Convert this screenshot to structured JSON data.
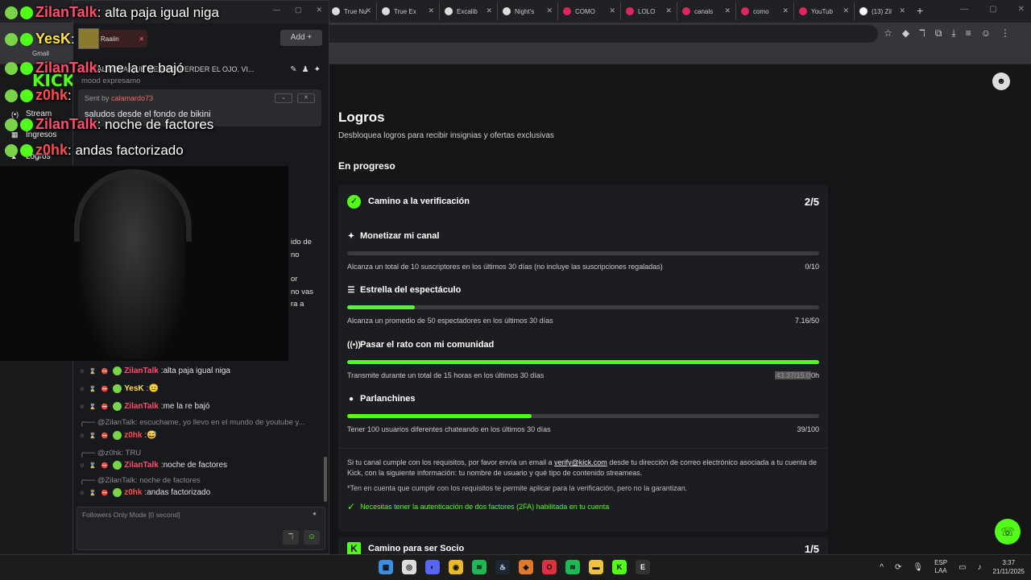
{
  "browser": {
    "tabs": [
      {
        "label": "True Nu",
        "color": "#dddddd"
      },
      {
        "label": "True Ex",
        "color": "#dddddd"
      },
      {
        "label": "Excalib",
        "color": "#dddddd"
      },
      {
        "label": "Night's",
        "color": "#dddddd"
      },
      {
        "label": "COMO",
        "color": "#e0245e"
      },
      {
        "label": "LOLO",
        "color": "#e0245e"
      },
      {
        "label": "canals",
        "color": "#e0245e"
      },
      {
        "label": "como",
        "color": "#e0245e"
      },
      {
        "label": "YouTub",
        "color": "#e0245e"
      },
      {
        "label": "(13) Zil",
        "color": "#ffffff"
      }
    ],
    "new_tab": "+",
    "bookmark": "Gmail"
  },
  "sidebar": {
    "logo": "KICK",
    "items": [
      {
        "label": "Stream",
        "icon": "(•)"
      },
      {
        "label": "Ingresos",
        "icon": "▦"
      },
      {
        "label": "Logros",
        "icon": "⧗"
      }
    ]
  },
  "chat_window": {
    "user_chip": "Raaiin",
    "add_label": "Add",
    "title": "EN TAL NENA QUE ME HIZO PERDER EL OJO. VI...",
    "subtitle": "mood expresamo",
    "pinned": {
      "sent_by_label": "Sent by",
      "sender": "calamardo73",
      "message": "saludos desde el fondo de bikini"
    },
    "partial_lines": [
      "ido de",
      "no",
      "or",
      "no vas",
      "ra a"
    ],
    "messages": [
      {
        "type": "msg",
        "user": "ZilanTalk",
        "color": "#ff4d6d",
        "text": "alta paja igual niga"
      },
      {
        "type": "msg",
        "user": "YesK",
        "color": "#ffe14d",
        "text": "😐"
      },
      {
        "type": "msg",
        "user": "ZilanTalk",
        "color": "#ff4d6d",
        "text": "me la re bajó"
      },
      {
        "type": "reply",
        "text": "@ZilanTalk: escuchame, yo llevo en el mundo de youtube y..."
      },
      {
        "type": "msg",
        "user": "z0hk",
        "color": "#ff4d4d",
        "text": "😅"
      },
      {
        "type": "reply",
        "text": "@z0hk: TRU"
      },
      {
        "type": "msg",
        "user": "ZilanTalk",
        "color": "#ff4d6d",
        "text": "noche de factores"
      },
      {
        "type": "reply",
        "text": "@ZilanTalk: noche de factores"
      },
      {
        "type": "msg",
        "user": "z0hk",
        "color": "#ff4d4d",
        "text": "andas factorizado"
      }
    ],
    "input_placeholder": "Followers Only Mode [0 second]"
  },
  "overlay": [
    {
      "user": "ZilanTalk",
      "color": "#ff4d6d",
      "text": ": alta paja igual niga"
    },
    {
      "user": "YesK",
      "color": "#ffe14d",
      "text": ":"
    },
    {
      "user": "ZilanTalk",
      "color": "#ff4d6d",
      "text": ": me la re bajó"
    },
    {
      "user": "z0hk",
      "color": "#ff4d4d",
      "text": ":"
    },
    {
      "user": "ZilanTalk",
      "color": "#ff4d6d",
      "text": ": noche de factores"
    },
    {
      "user": "z0hk",
      "color": "#ff4d4d",
      "text": ": andas factorizado"
    }
  ],
  "page": {
    "title": "Logros",
    "subtitle": "Desbloquea logros para recibir insignias y ofertas exclusivas",
    "section": "En progreso",
    "card": {
      "title": "Camino a la verificación",
      "count": "2/5",
      "goals": [
        {
          "icon": "✦",
          "title": "Monetizar mi canal",
          "desc": "Alcanza un total de 10 suscriptores en los últimos 30 días (no incluye las suscripciones regaladas)",
          "progress": "0/10",
          "fraction": 0.0
        },
        {
          "icon": "☰",
          "title": "Estrella del espectáculo",
          "desc": "Alcanza un promedio de 50 espectadores en los últimos 30 días",
          "progress": "7.16/50",
          "fraction": 0.143
        },
        {
          "icon": "((•))",
          "title": "Pasar el rato con mi comunidad",
          "desc": "Transmite durante un total de 15 horas en los últimos 30 días",
          "progress_hl": "43.37/15.0",
          "progress": "0h",
          "fraction": 1.0
        },
        {
          "icon": "●",
          "title": "Parlanchines",
          "desc": "Tener 100 usuarios diferentes chateando en los últimos 30 días",
          "progress": "39/100",
          "fraction": 0.39
        }
      ],
      "note_pre": "Si tu canal cumple con los requisitos, por favor envía un email a",
      "note_email": "verify@kick.com",
      "note_post": "desde tu dirección de correo electrónico asociada a tu cuenta de Kick, con la siguiente información: tu nombre de usuario y qué tipo de contenido streameas.",
      "note2": "*Ten en cuenta que cumplir con los requisitos te permite aplicar para la verificación, pero no la garantizan.",
      "twofa": "Necesitas tener la autenticación de dos factores (2FA) habilitada en tu cuenta"
    },
    "card2": {
      "title": "Camino para ser Socio",
      "count": "1/5"
    }
  },
  "taskbar": {
    "lang1": "ESP",
    "lang2": "LAA",
    "time": "3:37",
    "date": "21/11/2025"
  }
}
